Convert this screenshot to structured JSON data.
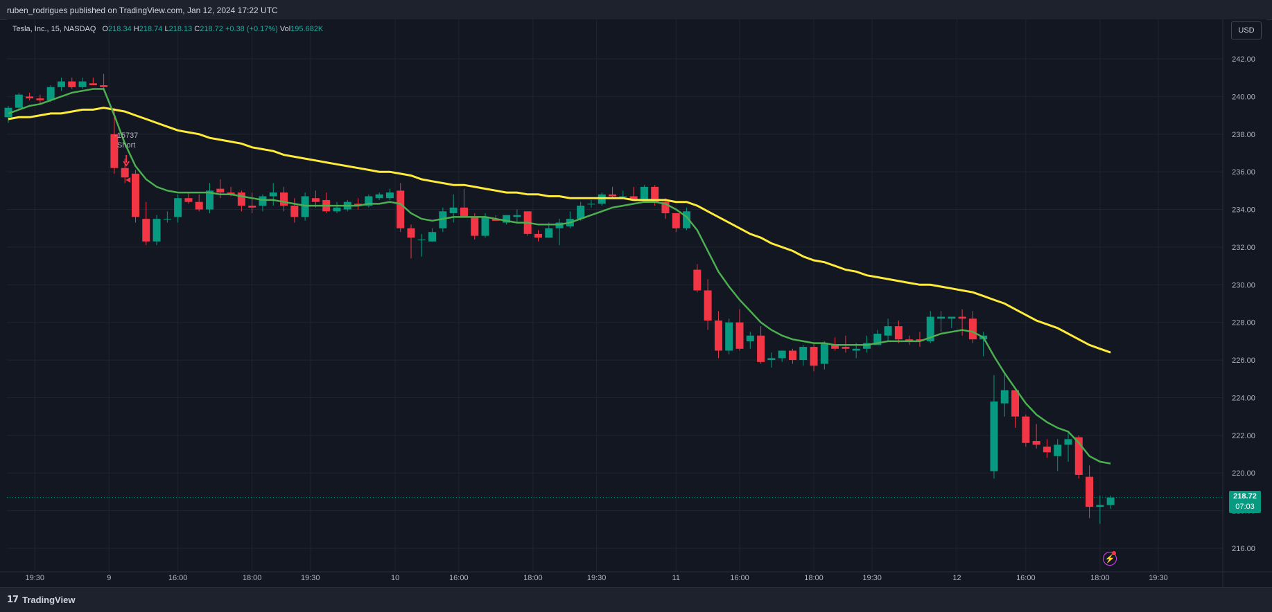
{
  "header": {
    "published_line": "ruben_rodrigues published on TradingView.com, Jan 12, 2024 17:22 UTC"
  },
  "legend": {
    "symbol": "Tesla, Inc., 15, NASDAQ",
    "o_label": "O",
    "o_value": "218.34",
    "h_label": "H",
    "h_value": "218.74",
    "l_label": "L",
    "l_value": "218.13",
    "c_label": "C",
    "c_value": "218.72",
    "change": "+0.38 (+0.17%)",
    "vol_label": "Vol",
    "vol_value": "195.682K"
  },
  "currency_button": "USD",
  "last_price": {
    "price": "218.72",
    "countdown": "07:03"
  },
  "footer": {
    "brand_logo": "17",
    "brand_name": "TradingView"
  },
  "colors": {
    "up": "#089981",
    "down": "#f23645",
    "ema_fast": "#4caf50",
    "ema_slow": "#ffeb3b",
    "background": "#131722",
    "grid": "#1f2430"
  },
  "chart_data": {
    "type": "candlestick",
    "title": "Tesla, Inc., 15, NASDAQ",
    "ylim": [
      215,
      243
    ],
    "y_ticks": [
      "216.00",
      "218.00",
      "220.00",
      "222.00",
      "224.00",
      "226.00",
      "228.00",
      "230.00",
      "232.00",
      "234.00",
      "236.00",
      "238.00",
      "240.00",
      "242.00"
    ],
    "x_ticks": [
      "19:30",
      "9",
      "16:00",
      "18:00",
      "19:30",
      "10",
      "16:00",
      "18:00",
      "19:30",
      "11",
      "16:00",
      "18:00",
      "19:30",
      "12",
      "16:00",
      "18:00",
      "19:30"
    ],
    "x_tick_index": [
      2.5,
      9.5,
      16,
      23,
      28.5,
      36.5,
      42.5,
      49.5,
      55.5,
      63,
      69,
      76,
      81.5,
      89.5,
      96,
      103,
      108.5
    ],
    "grid": true,
    "annotation": {
      "line1": "-15737",
      "line2": "Short",
      "index": 11
    },
    "candles": [
      [
        238.9,
        239.5,
        238.6,
        239.4
      ],
      [
        239.4,
        240.2,
        239.3,
        240.1
      ],
      [
        240.0,
        240.2,
        239.8,
        239.9
      ],
      [
        239.9,
        240.1,
        239.6,
        239.8
      ],
      [
        239.8,
        240.6,
        239.7,
        240.5
      ],
      [
        240.5,
        241.0,
        240.3,
        240.8
      ],
      [
        240.8,
        241.0,
        240.4,
        240.5
      ],
      [
        240.5,
        241.0,
        240.4,
        240.8
      ],
      [
        240.7,
        241.0,
        240.6,
        240.6
      ],
      [
        240.6,
        241.2,
        240.3,
        240.5
      ],
      [
        238.0,
        239.4,
        235.9,
        236.2
      ],
      [
        236.2,
        236.7,
        235.4,
        235.7
      ],
      [
        235.9,
        236.1,
        233.3,
        233.6
      ],
      [
        233.5,
        234.4,
        232.1,
        232.3
      ],
      [
        232.3,
        233.7,
        232.1,
        233.5
      ],
      [
        233.5,
        233.9,
        233.3,
        233.5
      ],
      [
        233.6,
        234.8,
        233.3,
        234.6
      ],
      [
        234.6,
        234.9,
        234.3,
        234.4
      ],
      [
        234.4,
        234.8,
        233.9,
        234.0
      ],
      [
        234.0,
        235.4,
        233.8,
        235.0
      ],
      [
        235.1,
        235.6,
        234.6,
        234.9
      ],
      [
        234.9,
        235.2,
        234.7,
        234.8
      ],
      [
        234.9,
        235.0,
        233.9,
        234.2
      ],
      [
        234.2,
        234.9,
        233.8,
        234.1
      ],
      [
        234.2,
        234.8,
        233.9,
        234.7
      ],
      [
        234.7,
        235.4,
        234.2,
        234.9
      ],
      [
        234.9,
        235.2,
        233.9,
        234.2
      ],
      [
        234.2,
        234.6,
        233.3,
        233.6
      ],
      [
        233.6,
        234.9,
        233.4,
        234.7
      ],
      [
        234.6,
        235.0,
        234.1,
        234.4
      ],
      [
        234.5,
        234.9,
        233.8,
        233.9
      ],
      [
        233.9,
        234.4,
        233.8,
        234.1
      ],
      [
        234.0,
        234.5,
        233.9,
        234.4
      ],
      [
        234.3,
        234.6,
        234.0,
        234.2
      ],
      [
        234.2,
        234.8,
        234.1,
        234.7
      ],
      [
        234.6,
        234.9,
        234.5,
        234.8
      ],
      [
        234.6,
        235.1,
        234.5,
        234.9
      ],
      [
        235.0,
        235.4,
        232.8,
        233.0
      ],
      [
        233.0,
        233.2,
        231.4,
        232.5
      ],
      [
        232.4,
        232.7,
        231.5,
        232.4
      ],
      [
        232.3,
        233.0,
        232.3,
        232.8
      ],
      [
        233.0,
        234.1,
        232.8,
        233.9
      ],
      [
        233.8,
        234.8,
        233.3,
        234.1
      ],
      [
        234.1,
        235.1,
        233.6,
        233.6
      ],
      [
        233.6,
        233.8,
        232.4,
        232.6
      ],
      [
        232.6,
        233.8,
        232.5,
        233.6
      ],
      [
        233.5,
        233.7,
        233.4,
        233.4
      ],
      [
        233.3,
        233.7,
        233.2,
        233.7
      ],
      [
        233.6,
        234.0,
        233.3,
        233.7
      ],
      [
        233.9,
        233.9,
        232.6,
        232.7
      ],
      [
        232.7,
        232.9,
        232.3,
        232.5
      ],
      [
        232.5,
        233.3,
        232.5,
        233.0
      ],
      [
        233.0,
        233.5,
        232.1,
        233.3
      ],
      [
        233.1,
        233.9,
        233.0,
        233.5
      ],
      [
        233.5,
        234.4,
        233.4,
        234.2
      ],
      [
        234.3,
        234.5,
        234.1,
        234.3
      ],
      [
        234.3,
        234.9,
        234.2,
        234.8
      ],
      [
        234.8,
        235.2,
        234.6,
        234.7
      ],
      [
        234.7,
        235.0,
        234.6,
        234.7
      ],
      [
        234.7,
        235.2,
        234.6,
        234.5
      ],
      [
        234.5,
        235.3,
        234.4,
        235.2
      ],
      [
        235.2,
        235.3,
        234.2,
        234.4
      ],
      [
        234.4,
        234.6,
        233.5,
        233.8
      ],
      [
        233.8,
        233.8,
        232.8,
        233.0
      ],
      [
        233.0,
        234.1,
        232.9,
        233.9
      ],
      [
        230.8,
        231.1,
        229.6,
        229.7
      ],
      [
        229.7,
        230.3,
        227.6,
        228.1
      ],
      [
        228.1,
        228.6,
        226.1,
        226.5
      ],
      [
        226.5,
        228.2,
        226.3,
        228.0
      ],
      [
        228.0,
        228.7,
        226.5,
        226.6
      ],
      [
        227.0,
        227.5,
        226.6,
        227.3
      ],
      [
        227.3,
        227.8,
        225.8,
        225.9
      ],
      [
        226.0,
        226.4,
        225.6,
        226.1
      ],
      [
        226.1,
        226.5,
        225.9,
        226.5
      ],
      [
        226.5,
        226.6,
        225.8,
        226.0
      ],
      [
        226.0,
        226.8,
        225.7,
        226.7
      ],
      [
        226.7,
        226.9,
        225.4,
        225.7
      ],
      [
        225.8,
        227.0,
        225.5,
        226.9
      ],
      [
        226.8,
        227.2,
        226.5,
        226.6
      ],
      [
        226.7,
        227.3,
        226.4,
        226.6
      ],
      [
        226.5,
        226.9,
        226.1,
        226.6
      ],
      [
        226.6,
        227.3,
        226.4,
        226.9
      ],
      [
        226.8,
        227.6,
        226.8,
        227.4
      ],
      [
        227.3,
        228.2,
        227.0,
        227.8
      ],
      [
        227.8,
        228.1,
        226.9,
        227.1
      ],
      [
        227.1,
        227.3,
        226.8,
        227.0
      ],
      [
        227.1,
        227.5,
        226.7,
        227.0
      ],
      [
        227.0,
        228.6,
        226.9,
        228.3
      ],
      [
        228.2,
        228.6,
        227.5,
        228.3
      ],
      [
        228.2,
        228.3,
        227.7,
        228.3
      ],
      [
        228.3,
        228.7,
        227.3,
        228.2
      ],
      [
        228.2,
        228.6,
        226.9,
        227.1
      ],
      [
        227.1,
        227.5,
        226.2,
        227.3
      ],
      [
        220.1,
        225.2,
        219.7,
        223.8
      ],
      [
        223.7,
        225.3,
        223.0,
        224.4
      ],
      [
        224.4,
        224.4,
        222.4,
        223.0
      ],
      [
        223.0,
        223.1,
        221.4,
        221.6
      ],
      [
        221.7,
        222.6,
        221.3,
        221.5
      ],
      [
        221.4,
        221.8,
        220.8,
        221.1
      ],
      [
        220.9,
        221.8,
        220.1,
        221.5
      ],
      [
        221.5,
        222.2,
        220.6,
        221.8
      ],
      [
        221.9,
        222.0,
        219.7,
        219.9
      ],
      [
        219.8,
        220.4,
        217.6,
        218.2
      ],
      [
        218.2,
        218.8,
        217.3,
        218.3
      ],
      [
        218.3,
        218.8,
        218.1,
        218.7
      ]
    ],
    "series": [
      {
        "name": "",
        "values": [
          239.1,
          239.3,
          239.5,
          239.6,
          239.8,
          240.0,
          240.2,
          240.3,
          240.4,
          240.4,
          239.0,
          237.5,
          236.3,
          235.6,
          235.2,
          235.0,
          234.9,
          234.9,
          234.9,
          234.9,
          234.8,
          234.8,
          234.7,
          234.6,
          234.5,
          234.5,
          234.4,
          234.3,
          234.2,
          234.2,
          234.2,
          234.2,
          234.2,
          234.2,
          234.3,
          234.3,
          234.4,
          234.3,
          233.8,
          233.5,
          233.4,
          233.5,
          233.6,
          233.6,
          233.6,
          233.6,
          233.5,
          233.4,
          233.3,
          233.3,
          233.2,
          233.2,
          233.2,
          233.3,
          233.5,
          233.7,
          233.9,
          234.1,
          234.2,
          234.3,
          234.4,
          234.4,
          234.3,
          234.0,
          233.6,
          232.9,
          231.8,
          230.7,
          229.9,
          229.2,
          228.6,
          228.0,
          227.6,
          227.3,
          227.1,
          227.0,
          226.9,
          226.9,
          226.8,
          226.8,
          226.8,
          226.8,
          226.9,
          227.0,
          227.0,
          227.0,
          227.0,
          227.2,
          227.4,
          227.5,
          227.6,
          227.5,
          227.2,
          226.2,
          225.3,
          224.5,
          223.7,
          223.1,
          222.7,
          222.4,
          222.2,
          221.6,
          220.9,
          220.6,
          220.5
        ]
      },
      {
        "name": "",
        "values": [
          238.8,
          238.9,
          238.9,
          239.0,
          239.1,
          239.1,
          239.2,
          239.3,
          239.3,
          239.4,
          239.3,
          239.2,
          239.0,
          238.8,
          238.6,
          238.4,
          238.2,
          238.1,
          238.0,
          237.8,
          237.7,
          237.6,
          237.5,
          237.3,
          237.2,
          237.1,
          236.9,
          236.8,
          236.7,
          236.6,
          236.5,
          236.4,
          236.3,
          236.2,
          236.1,
          236.0,
          236.0,
          235.9,
          235.8,
          235.6,
          235.5,
          235.4,
          235.3,
          235.3,
          235.2,
          235.1,
          235.0,
          234.9,
          234.9,
          234.8,
          234.8,
          234.7,
          234.7,
          234.6,
          234.6,
          234.6,
          234.6,
          234.6,
          234.6,
          234.5,
          234.5,
          234.5,
          234.5,
          234.4,
          234.4,
          234.2,
          233.9,
          233.6,
          233.3,
          233.0,
          232.7,
          232.5,
          232.2,
          232.0,
          231.8,
          231.5,
          231.3,
          231.2,
          231.0,
          230.8,
          230.7,
          230.5,
          230.4,
          230.3,
          230.2,
          230.1,
          230.0,
          230.0,
          229.9,
          229.8,
          229.7,
          229.6,
          229.4,
          229.2,
          229.0,
          228.7,
          228.4,
          228.1,
          227.9,
          227.7,
          227.4,
          227.1,
          226.8,
          226.6,
          226.4
        ]
      }
    ]
  }
}
